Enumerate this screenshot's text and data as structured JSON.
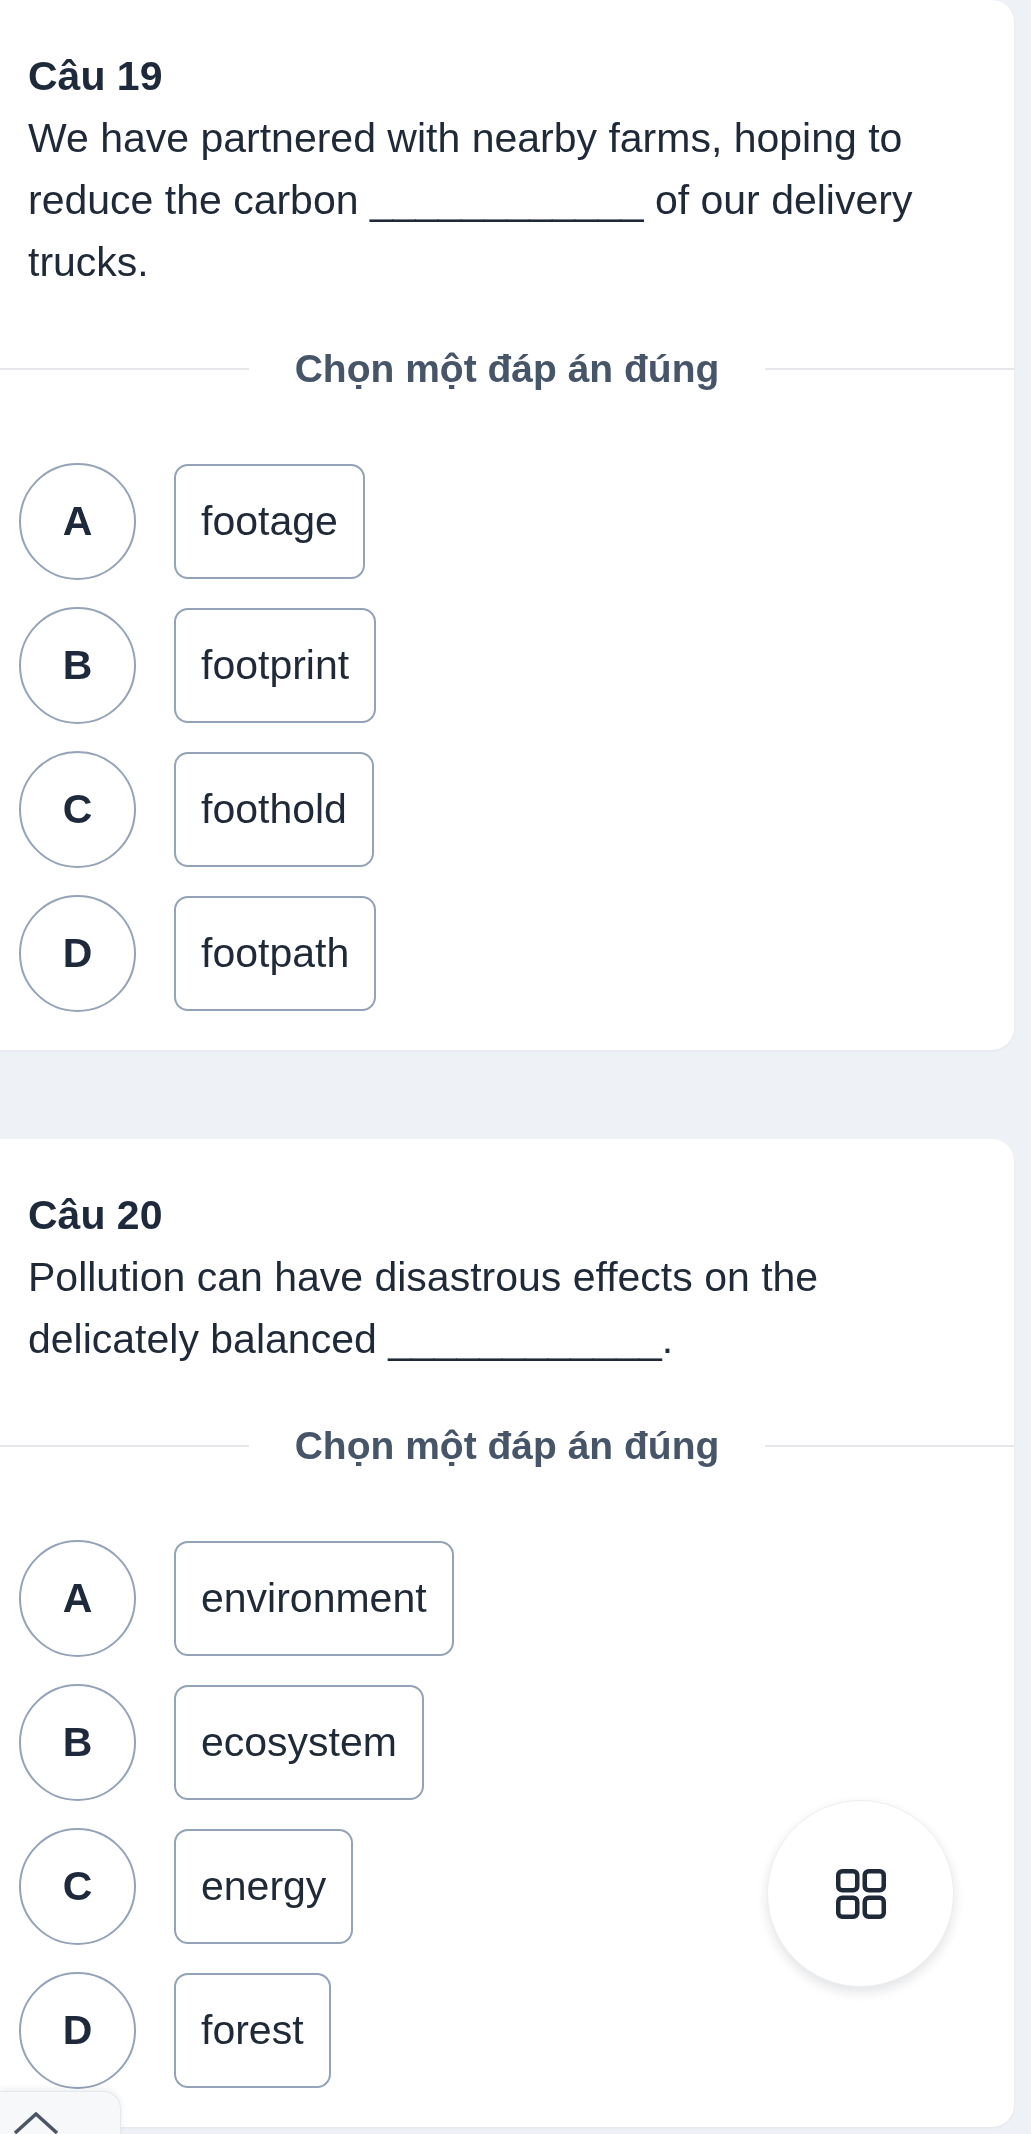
{
  "questions": [
    {
      "title": "Câu 19",
      "text": "We have partnered with nearby farms, hoping to reduce the carbon ____________ of our delivery trucks.",
      "prompt": "Chọn một đáp án đúng",
      "options": [
        {
          "letter": "A",
          "text": "footage",
          "selected": false
        },
        {
          "letter": "B",
          "text": "footprint",
          "selected": false
        },
        {
          "letter": "C",
          "text": "foothold",
          "selected": false
        },
        {
          "letter": "D",
          "text": "footpath",
          "selected": false
        }
      ]
    },
    {
      "title": "Câu 20",
      "text": "Pollution can have disastrous effects on the delicately balanced ____________.",
      "prompt": "Chọn một đáp án đúng",
      "options": [
        {
          "letter": "A",
          "text": "environment",
          "selected": false
        },
        {
          "letter": "B",
          "text": "ecosystem",
          "selected": false
        },
        {
          "letter": "C",
          "text": "energy",
          "selected": false
        },
        {
          "letter": "D",
          "text": "forest",
          "selected": false
        }
      ]
    }
  ]
}
